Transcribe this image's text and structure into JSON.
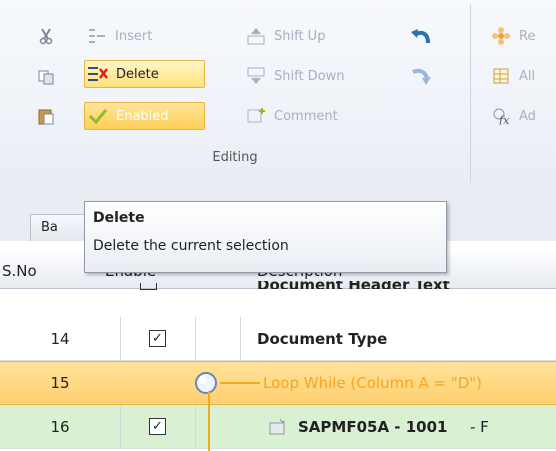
{
  "ribbon": {
    "clipboard": {
      "cut_icon": "scissors-icon",
      "copy_icon": "copy-icon",
      "paste_icon": "paste-icon"
    },
    "insert_label": "Insert",
    "delete_label": "Delete",
    "enabled_label": "Enabled",
    "shift_up_label": "Shift Up",
    "shift_down_label": "Shift Down",
    "comment_label": "Comment",
    "undo_icon": "undo-icon",
    "redo_icon": "redo-icon",
    "next_group_labels": [
      "Re",
      "All",
      "Ad"
    ],
    "group_label": "Editing"
  },
  "tabs": [
    {
      "label": "Ba"
    }
  ],
  "tooltip": {
    "title": "Delete",
    "description": "Delete the current selection"
  },
  "grid": {
    "columns": [
      "S.No",
      "Enable",
      "Description"
    ],
    "partial_row": {
      "text": "Document Header Text"
    },
    "rows": [
      {
        "sno": "14",
        "enabled": true,
        "description": "Document Type"
      },
      {
        "sno": "15",
        "loop_text": "Loop While (Column A = \"D\")"
      },
      {
        "sno": "16",
        "enabled": true,
        "description": "SAPMF05A - 1001",
        "suffix": "- F"
      }
    ]
  },
  "colors": {
    "accent_orange": "#f5a623",
    "loop_row": "#ffd67a",
    "green_row": "#d9f0d3"
  }
}
